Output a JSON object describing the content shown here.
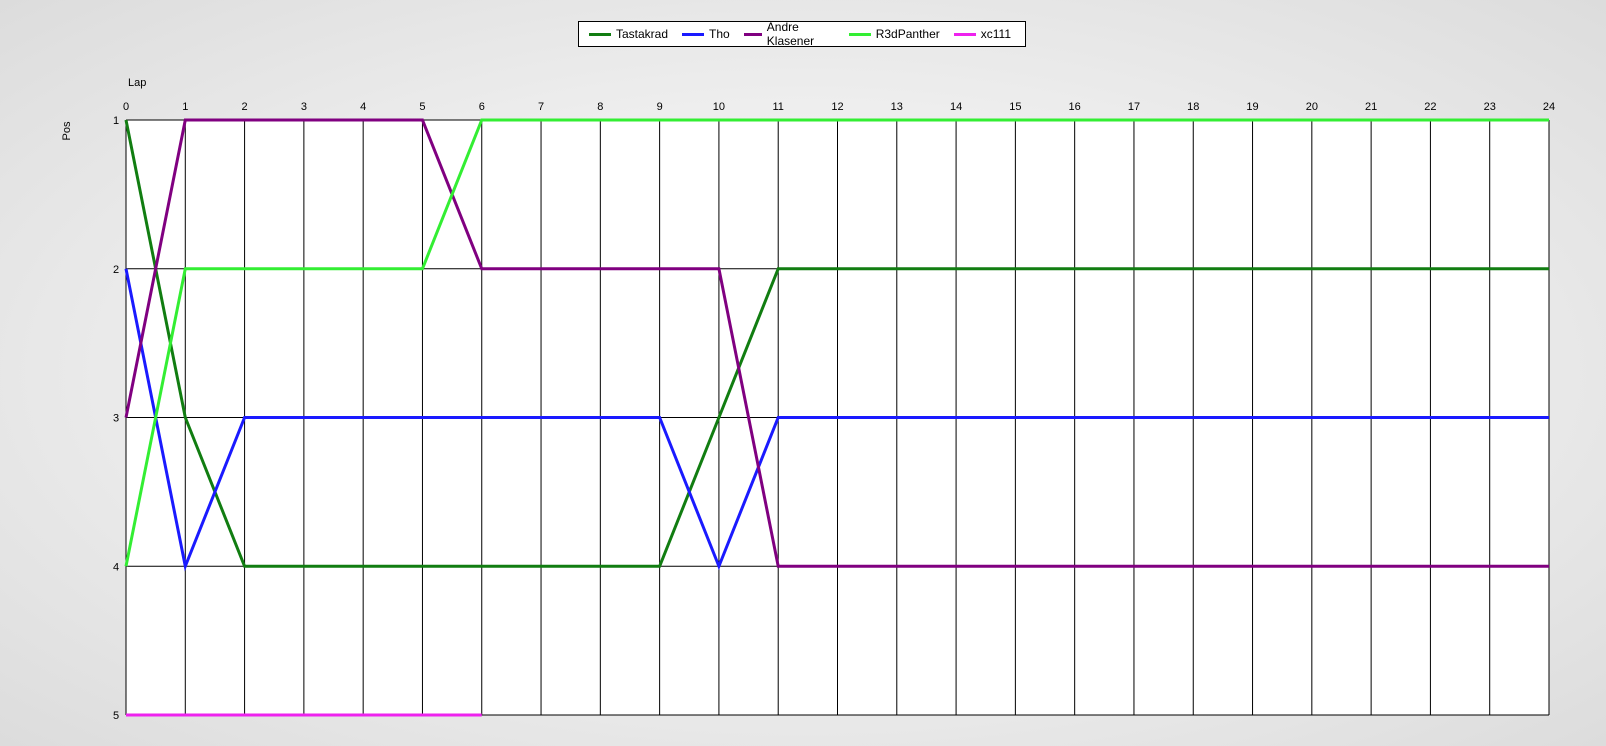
{
  "chart_data": {
    "type": "line",
    "xlabel": "Lap",
    "ylabel": "Pos",
    "x_ticks": [
      0,
      1,
      2,
      3,
      4,
      5,
      6,
      7,
      8,
      9,
      10,
      11,
      12,
      13,
      14,
      15,
      16,
      17,
      18,
      19,
      20,
      21,
      22,
      23,
      24
    ],
    "y_ticks": [
      1,
      2,
      3,
      4,
      5
    ],
    "xlim": [
      0,
      24
    ],
    "ylim": [
      1,
      5
    ],
    "y_inverted": true,
    "grid": true,
    "legend_position": "top-center",
    "series": [
      {
        "name": "Tastakrad",
        "color": "#117d11",
        "x": [
          0,
          1,
          2,
          3,
          4,
          5,
          6,
          7,
          8,
          9,
          10,
          11,
          12,
          13,
          14,
          15,
          16,
          17,
          18,
          19,
          20,
          21,
          22,
          23,
          24
        ],
        "y": [
          1,
          3,
          4,
          4,
          4,
          4,
          4,
          4,
          4,
          4,
          3,
          2,
          2,
          2,
          2,
          2,
          2,
          2,
          2,
          2,
          2,
          2,
          2,
          2,
          2
        ]
      },
      {
        "name": "Tho",
        "color": "#1a1aff",
        "x": [
          0,
          1,
          2,
          3,
          4,
          5,
          6,
          7,
          8,
          9,
          10,
          11,
          12,
          13,
          14,
          15,
          16,
          17,
          18,
          19,
          20,
          21,
          22,
          23,
          24
        ],
        "y": [
          2,
          4,
          3,
          3,
          3,
          3,
          3,
          3,
          3,
          3,
          4,
          3,
          3,
          3,
          3,
          3,
          3,
          3,
          3,
          3,
          3,
          3,
          3,
          3,
          3
        ]
      },
      {
        "name": "Andre Klasener",
        "color": "#800080",
        "x": [
          0,
          1,
          2,
          3,
          4,
          5,
          6,
          7,
          8,
          9,
          10,
          11,
          12,
          13,
          14,
          15,
          16,
          17,
          18,
          19,
          20,
          21,
          22,
          23,
          24
        ],
        "y": [
          3,
          1,
          1,
          1,
          1,
          1,
          2,
          2,
          2,
          2,
          2,
          4,
          4,
          4,
          4,
          4,
          4,
          4,
          4,
          4,
          4,
          4,
          4,
          4,
          4
        ]
      },
      {
        "name": "R3dPanther",
        "color": "#33ee33",
        "x": [
          0,
          1,
          2,
          3,
          4,
          5,
          6,
          7,
          8,
          9,
          10,
          11,
          12,
          13,
          14,
          15,
          16,
          17,
          18,
          19,
          20,
          21,
          22,
          23,
          24
        ],
        "y": [
          4,
          2,
          2,
          2,
          2,
          2,
          1,
          1,
          1,
          1,
          1,
          1,
          1,
          1,
          1,
          1,
          1,
          1,
          1,
          1,
          1,
          1,
          1,
          1,
          1
        ]
      },
      {
        "name": "xc111",
        "color": "#ee22ee",
        "x": [
          0,
          1,
          2,
          3,
          4,
          5,
          6
        ],
        "y": [
          5,
          5,
          5,
          5,
          5,
          5,
          5
        ]
      }
    ]
  }
}
